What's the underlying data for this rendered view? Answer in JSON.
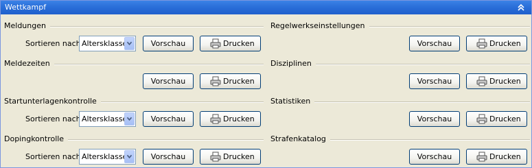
{
  "panel": {
    "title": "Wettkampf",
    "collapse_icon": "double-chevron-up-icon"
  },
  "labels": {
    "sort_by": "Sortieren nach",
    "preview": "Vorschau",
    "print": "Drucken"
  },
  "sort_select": {
    "value": "Altersklasse"
  },
  "sections": {
    "meldungen": {
      "heading": "Meldungen"
    },
    "meldezeiten": {
      "heading": "Meldezeiten"
    },
    "startunterlagenkontrolle": {
      "heading": "Startunterlagenkontrolle"
    },
    "dopingkontrolle": {
      "heading": "Dopingkontrolle"
    },
    "regelwerkseinstellungen": {
      "heading": "Regelwerkseinstellungen"
    },
    "disziplinen": {
      "heading": "Disziplinen"
    },
    "statistiken": {
      "heading": "Statistiken"
    },
    "strafenkatalog": {
      "heading": "Strafenkatalog"
    }
  },
  "colors": {
    "titlebar": "#2a6fd9",
    "panel_background": "#ece9d8",
    "button_border": "#003c74"
  }
}
